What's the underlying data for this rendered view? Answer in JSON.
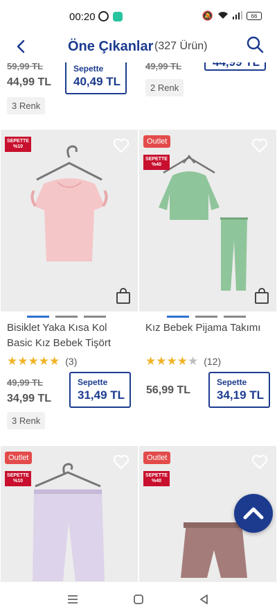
{
  "status": {
    "time": "00:20",
    "battery": "66"
  },
  "header": {
    "title": "Öne Çıkanlar",
    "count": "(327 Ürün)"
  },
  "top_row": {
    "left": {
      "old_price": "59,99 TL",
      "price": "44,99 TL",
      "basket_label": "Sepette",
      "basket_price": "40,49 TL",
      "colors": "3 Renk"
    },
    "right": {
      "old_price": "49,99 TL",
      "basket_price": "44,99 TL",
      "colors": "2 Renk"
    }
  },
  "products": [
    {
      "name": "Bisiklet Yaka Kısa Kol Basic Kız Bebek Tişört",
      "rating": 5,
      "rating_count": "(3)",
      "old_price": "49,99 TL",
      "price": "34,99 TL",
      "basket_label": "Sepette",
      "basket_price": "31,49 TL",
      "colors": "3 Renk",
      "outlet": false,
      "badge_line1": "SEPETTE",
      "badge_line2": "%10"
    },
    {
      "name": "Kız Bebek Pijama Takımı",
      "rating": 4,
      "rating_count": "(12)",
      "old_price": "",
      "price": "56,99 TL",
      "basket_label": "Sepette",
      "basket_price": "34,19 TL",
      "colors": "",
      "outlet": true,
      "outlet_label": "Outlet",
      "badge_line1": "SEPETTE",
      "badge_line2": "%40"
    }
  ],
  "bottom_row": {
    "left": {
      "outlet_label": "Outlet",
      "badge_line1": "SEPETTE",
      "badge_line2": "%10"
    },
    "right": {
      "outlet_label": "Outlet",
      "badge_line1": "SEPETTE",
      "badge_line2": "%40"
    }
  },
  "colors": {
    "brand": "#1c3b8f",
    "outlet": "#e34b4b",
    "sepette_badge": "#c8102e",
    "star": "#f0b429"
  }
}
